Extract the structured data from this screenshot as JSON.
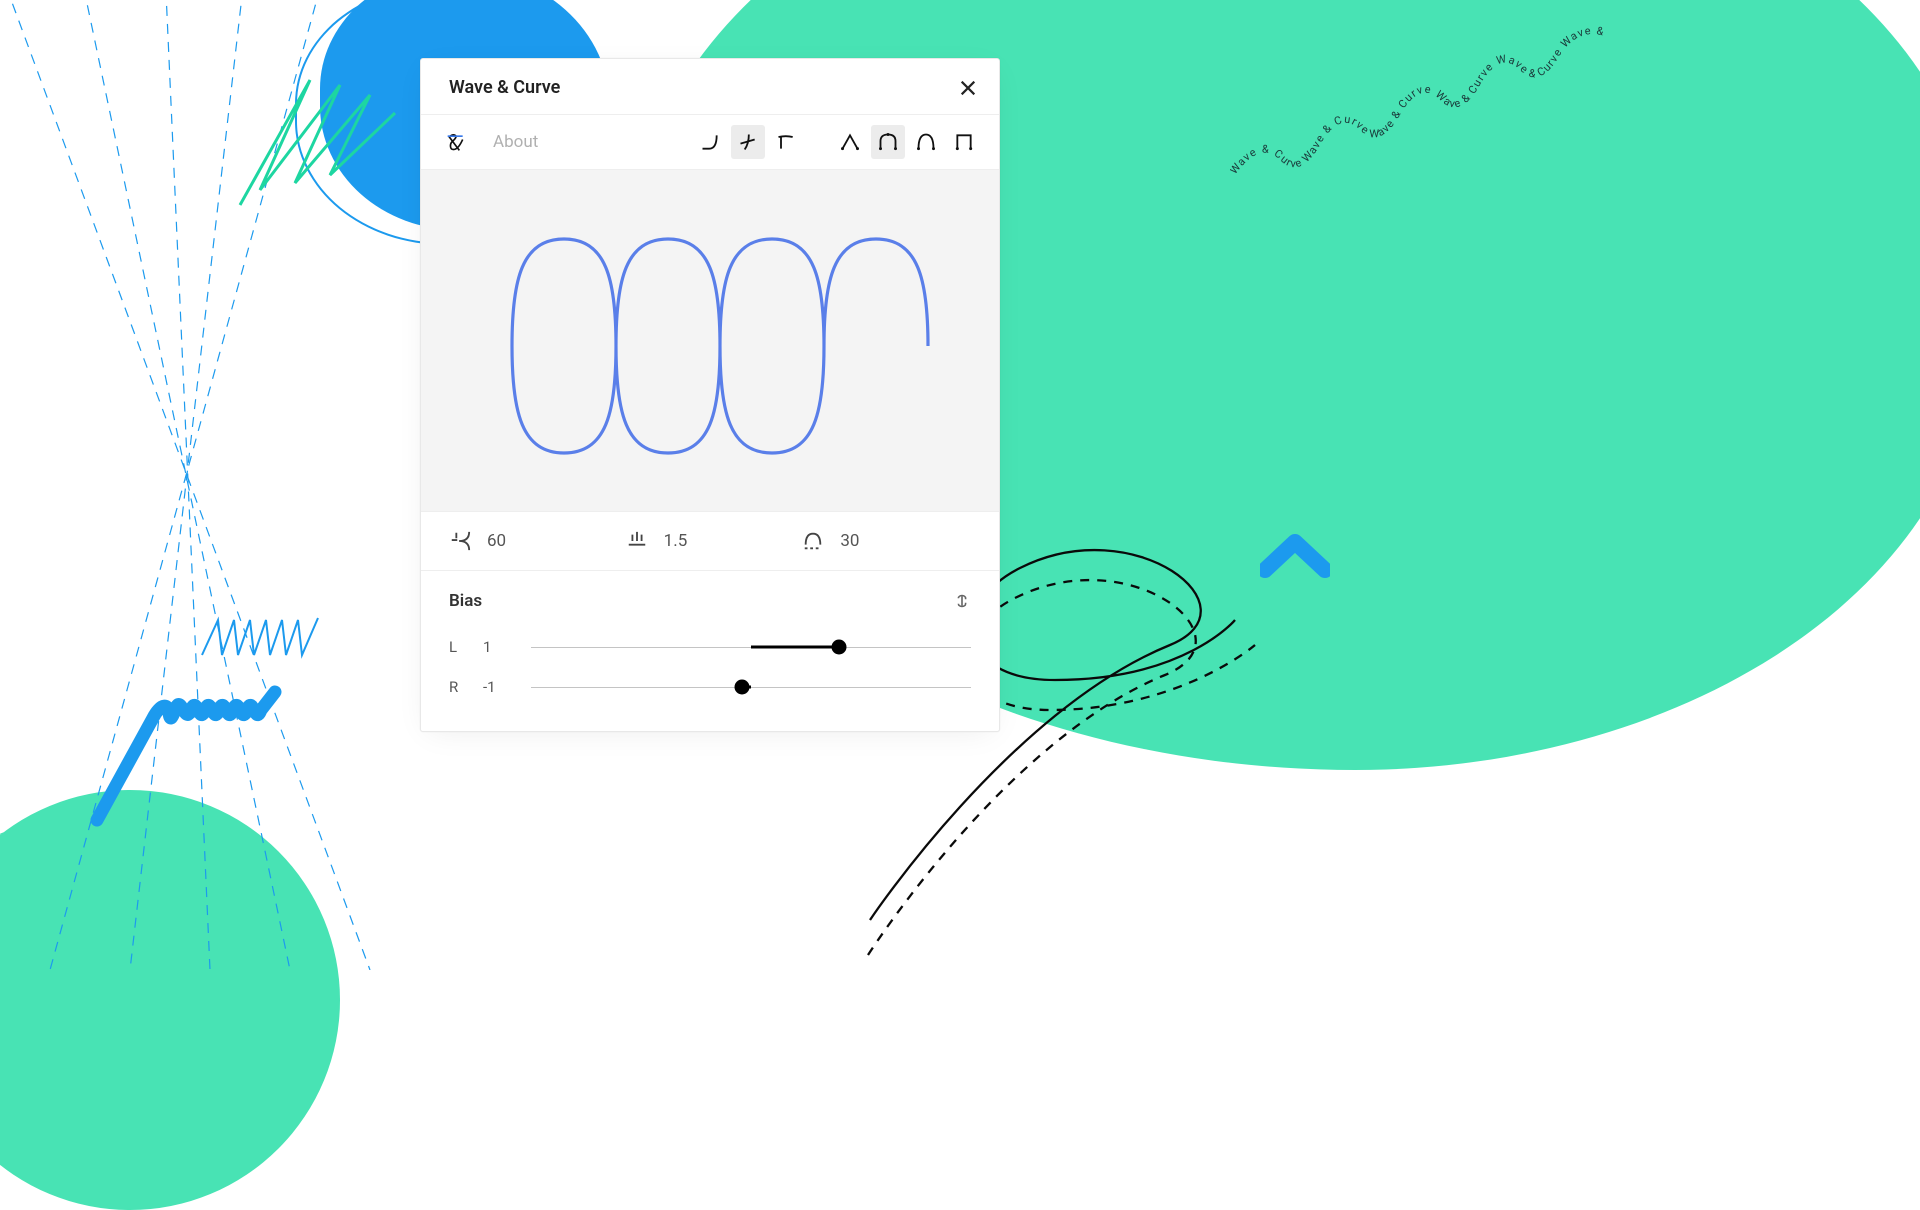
{
  "app": {
    "title": "Wave & Curve"
  },
  "toolbar": {
    "about": "About"
  },
  "params": {
    "angle": "60",
    "stroke": "1.5",
    "curve": "30"
  },
  "bias": {
    "label": "Bias",
    "L": {
      "label": "L",
      "value": "1",
      "pos": 0.7
    },
    "R": {
      "label": "R",
      "value": "-1",
      "pos": 0.48
    }
  },
  "decor": {
    "wave_text": "Wave & Curve Wave & Curve Wave & Curve Wave & Curve Wave & Curve Wave & Curve Wa"
  }
}
